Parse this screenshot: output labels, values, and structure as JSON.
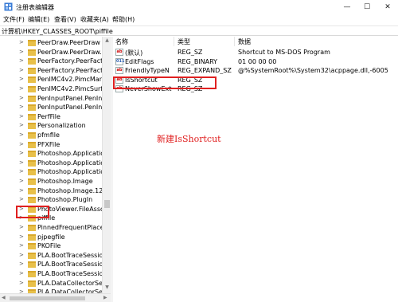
{
  "window": {
    "title": "注册表编辑器",
    "minimize_glyph": "—",
    "maximize_glyph": "☐",
    "close_glyph": "✕"
  },
  "menu": [
    "文件(F)",
    "编辑(E)",
    "查看(V)",
    "收藏夹(A)",
    "帮助(H)"
  ],
  "address": "计算机\\HKEY_CLASSES_ROOT\\piffile",
  "tree": {
    "items": [
      {
        "label": "PeerDraw.PeerDraw",
        "chevron": ">"
      },
      {
        "label": "PeerDraw.PeerDraw.1",
        "chevron": ">"
      },
      {
        "label": "PeerFactory.PeerFacto",
        "chevron": ">"
      },
      {
        "label": "PeerFactory.PeerFacto",
        "chevron": ">"
      },
      {
        "label": "PenIMC4v2.PimcMana",
        "chevron": ">"
      },
      {
        "label": "PenIMC4v2.PimcSurfa",
        "chevron": ">"
      },
      {
        "label": "PenInputPanel.PenInp",
        "chevron": ">"
      },
      {
        "label": "PenInputPanel.PenInp",
        "chevron": ">"
      },
      {
        "label": "PerfFile",
        "chevron": ">"
      },
      {
        "label": "Personalization",
        "chevron": ">"
      },
      {
        "label": "pfmfile",
        "chevron": ">"
      },
      {
        "label": "PFXFile",
        "chevron": ">"
      },
      {
        "label": "Photoshop.Applicatio",
        "chevron": ">"
      },
      {
        "label": "Photoshop.Applicatio",
        "chevron": ">"
      },
      {
        "label": "Photoshop.Applicatio",
        "chevron": ">"
      },
      {
        "label": "Photoshop.Image",
        "chevron": ">"
      },
      {
        "label": "Photoshop.Image.12",
        "chevron": ">"
      },
      {
        "label": "Photoshop.PlugIn",
        "chevron": ">"
      },
      {
        "label": "PhotoViewer.FileAsso",
        "chevron": ">"
      },
      {
        "label": "piffile",
        "chevron": ">"
      },
      {
        "label": "PinnedFrequentPlace",
        "chevron": ">"
      },
      {
        "label": "pjpegfile",
        "chevron": ">"
      },
      {
        "label": "PKOFile",
        "chevron": ">"
      },
      {
        "label": "PLA.BootTraceSession",
        "chevron": ">"
      },
      {
        "label": "PLA.BootTraceSession",
        "chevron": ">"
      },
      {
        "label": "PLA.BootTraceSession",
        "chevron": ">"
      },
      {
        "label": "PLA.DataCollectorSet",
        "chevron": ">"
      },
      {
        "label": "PLA.DataCollectorSet",
        "chevron": ">"
      }
    ],
    "selected": "piffile"
  },
  "values": {
    "headers": {
      "name": "名称",
      "type": "类型",
      "data": "数据"
    },
    "rows": [
      {
        "icon": "ab",
        "name": "(默认)",
        "type": "REG_SZ",
        "data": "Shortcut to MS-DOS Program"
      },
      {
        "icon": "bin",
        "name": "EditFlags",
        "type": "REG_BINARY",
        "data": "01 00 00 00"
      },
      {
        "icon": "ab",
        "name": "FriendlyTypeN",
        "type": "REG_EXPAND_SZ",
        "data": "@%SystemRoot%\\System32\\acppage.dll,-6005"
      },
      {
        "icon": "ab",
        "name": "IsShortcut",
        "type": "REG_SZ",
        "data": ""
      },
      {
        "icon": "ab",
        "name": "NeverShowExt",
        "type": "REG_SZ",
        "data": ""
      }
    ]
  },
  "annotation": "新建IsShortcut",
  "colors": {
    "highlight": "#e02020",
    "folder": "#e8c04a"
  }
}
